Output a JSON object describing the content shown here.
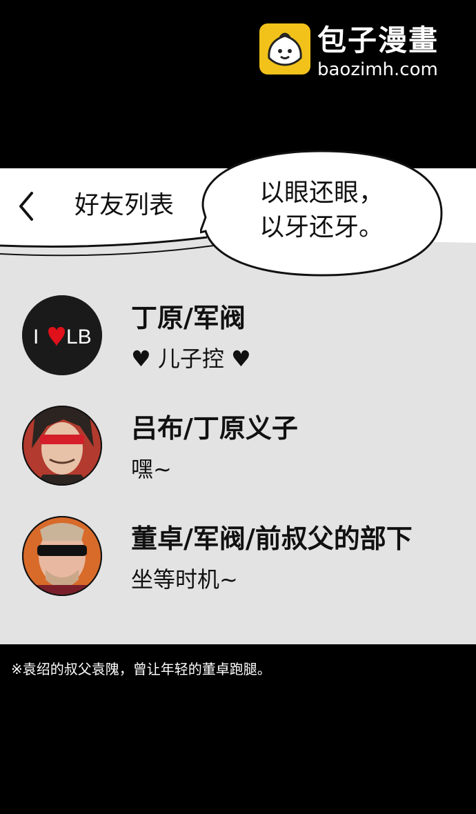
{
  "watermark": {
    "title": "包子漫畫",
    "url": "baozimh.com"
  },
  "header": {
    "back_icon": "chevron-left-icon",
    "title": "好友列表"
  },
  "speech_bubble": {
    "line1": "以眼还眼，",
    "line2": "以牙还牙。"
  },
  "friends": [
    {
      "name": "丁原/军阀",
      "status": "♥ 儿子控 ♥",
      "avatar_text": "I♥LB"
    },
    {
      "name": "吕布/丁原义子",
      "status": "嘿~"
    },
    {
      "name": "董卓/军阀/前叔父的部下",
      "status": "坐等时机~"
    }
  ],
  "footnote": "※袁绍的叔父袁隗，曾让年轻的董卓跑腿。",
  "colors": {
    "background": "#000000",
    "panel": "#e3e3e3",
    "header": "#ffffff",
    "text": "#111111",
    "accent_heart": "#e0111a",
    "logo_yellow": "#f2c21a"
  }
}
